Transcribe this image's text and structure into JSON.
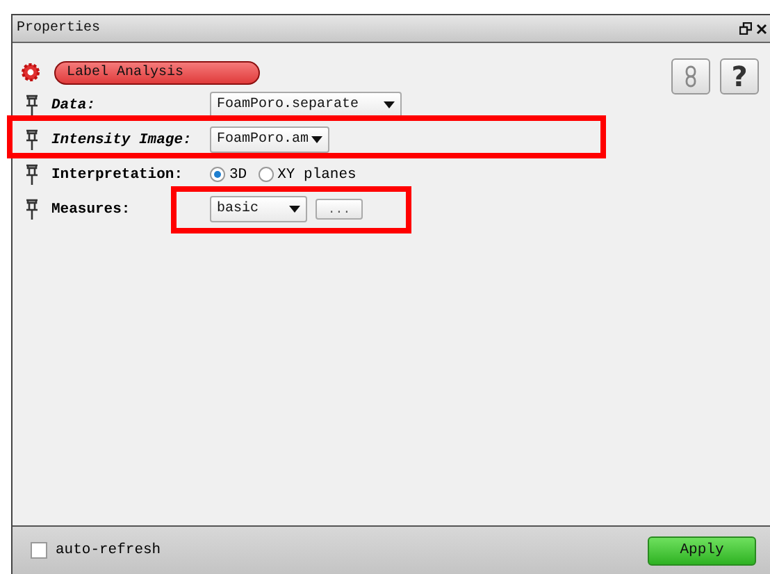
{
  "window": {
    "title": "Properties"
  },
  "module": {
    "name": "Label Analysis",
    "help_button": "?"
  },
  "ports": [
    {
      "kind": "dropdown",
      "connection": true,
      "label": "Data:",
      "value": "FoamPoro.separate",
      "highlighted": false
    },
    {
      "kind": "dropdown",
      "connection": true,
      "label": "Intensity Image:",
      "value": "FoamPoro.am",
      "highlighted": true
    },
    {
      "kind": "radio",
      "connection": false,
      "label": "Interpretation:",
      "options": [
        {
          "label": "3D",
          "selected": true
        },
        {
          "label": "XY planes",
          "selected": false
        }
      ],
      "highlighted": false
    },
    {
      "kind": "menu",
      "connection": false,
      "label": "Measures:",
      "value": "basic",
      "button": "...",
      "highlighted": true
    }
  ],
  "footer": {
    "auto_refresh": {
      "label": "auto-refresh",
      "checked": false
    },
    "apply_button": "Apply"
  }
}
